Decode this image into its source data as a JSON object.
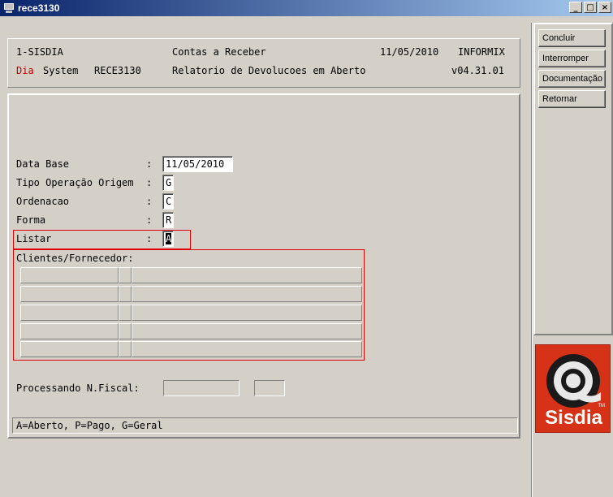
{
  "window": {
    "title": "rece3130",
    "buttons": [
      "_",
      "□",
      "×"
    ]
  },
  "header": {
    "line1": {
      "company": "1-SISDIA",
      "module": "Contas a Receber",
      "date": "11/05/2010",
      "db": "INFORMIX"
    },
    "line2": {
      "brand_red": "Dia",
      "brand_rest": "System",
      "program": "RECE3130",
      "report": "Relatorio de Devolucoes em Aberto",
      "version": "v04.31.01"
    }
  },
  "sidebar": {
    "concluir": "Concluir",
    "interromper": "Interromper",
    "documentacao": "Documentação",
    "retornar": "Retornar"
  },
  "form": {
    "data_base": {
      "label": "Data Base",
      "sep": ":",
      "value": "11/05/2010"
    },
    "tipo_operacao": {
      "label": "Tipo Operação Origem",
      "sep": ":",
      "value": "G"
    },
    "ordenacao": {
      "label": "Ordenacao",
      "sep": ":",
      "value": "C"
    },
    "forma": {
      "label": "Forma",
      "sep": ":",
      "value": "R"
    },
    "listar": {
      "label": "Listar",
      "sep": ":",
      "value": "A"
    },
    "clientes_label": "Clientes/Fornecedor:",
    "processando_label": "Processando N.Fiscal:"
  },
  "status": {
    "help": "A=Aberto, P=Pago, G=Geral"
  },
  "logo": {
    "text": "Sisdia",
    "tm": "TM",
    "colors": {
      "background": "#d63218",
      "ring": "#1a1a1a",
      "inner": "#e8e8e8"
    }
  }
}
